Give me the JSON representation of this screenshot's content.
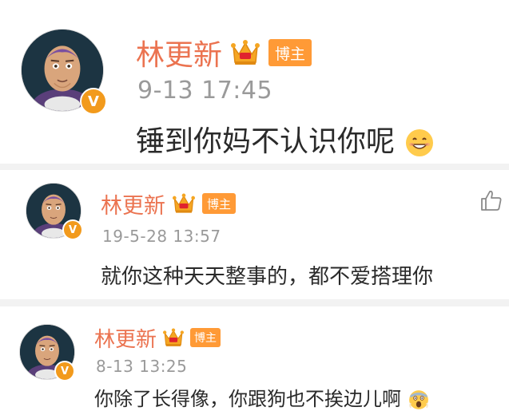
{
  "comments": [
    {
      "username": "林更新",
      "tag": "博主",
      "timestamp": "9-13 17:45",
      "text": "锤到你妈不认识你呢",
      "verified_badge": "V",
      "emoji": "grinning-face-emoji"
    },
    {
      "username": "林更新",
      "tag": "博主",
      "timestamp": "19-5-28 13:57",
      "text": "就你这种天天整事的，都不爱搭理你",
      "verified_badge": "V",
      "like_icon": "thumbs-up-icon"
    },
    {
      "username": "林更新",
      "tag": "博主",
      "timestamp": "8-13 13:25",
      "text": "你除了长得像，你跟狗也不挨边儿啊",
      "verified_badge": "V",
      "emoji": "screaming-face-emoji"
    }
  ],
  "colors": {
    "username": "#eb7350",
    "tag_background": "#ff9a36",
    "verified_badge": "#f29a1c",
    "timestamp": "#9a9a9a",
    "crown": "#f5a623"
  }
}
